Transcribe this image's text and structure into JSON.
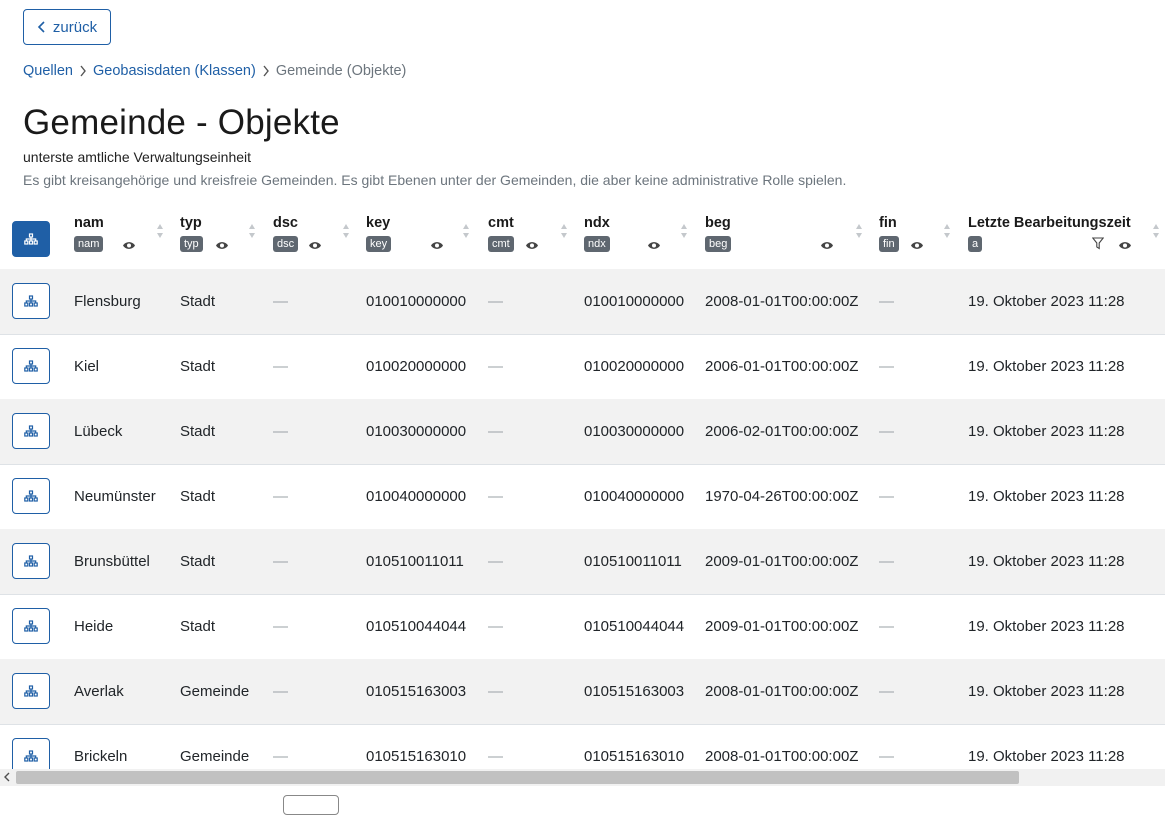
{
  "back_label": "zurück",
  "breadcrumb": {
    "items": [
      "Quellen",
      "Geobasisdaten (Klassen)"
    ],
    "current": "Gemeinde (Objekte)"
  },
  "page": {
    "title": "Gemeinde - Objekte",
    "subtitle": "unterste amtliche Verwaltungseinheit",
    "description": "Es gibt kreisangehörige und kreisfreie Gemeinden. Es gibt Ebenen unter der Gemeinden, die aber keine administrative Rolle spielen."
  },
  "table": {
    "columns": [
      {
        "name": "nam",
        "badge": "nam"
      },
      {
        "name": "typ",
        "badge": "typ"
      },
      {
        "name": "dsc",
        "badge": "dsc"
      },
      {
        "name": "key",
        "badge": "key"
      },
      {
        "name": "cmt",
        "badge": "cmt"
      },
      {
        "name": "ndx",
        "badge": "ndx"
      },
      {
        "name": "beg",
        "badge": "beg"
      },
      {
        "name": "fin",
        "badge": "fin"
      },
      {
        "name": "Letzte Bearbeitungszeit",
        "badge": "a"
      }
    ],
    "rows": [
      {
        "nam": "Flensburg",
        "typ": "Stadt",
        "dsc": "—",
        "key": "010010000000",
        "cmt": "—",
        "ndx": "010010000000",
        "beg": "2008-01-01T00:00:00Z",
        "fin": "—",
        "edited": "19. Oktober 2023 11:28"
      },
      {
        "nam": "Kiel",
        "typ": "Stadt",
        "dsc": "—",
        "key": "010020000000",
        "cmt": "—",
        "ndx": "010020000000",
        "beg": "2006-01-01T00:00:00Z",
        "fin": "—",
        "edited": "19. Oktober 2023 11:28"
      },
      {
        "nam": "Lübeck",
        "typ": "Stadt",
        "dsc": "—",
        "key": "010030000000",
        "cmt": "—",
        "ndx": "010030000000",
        "beg": "2006-02-01T00:00:00Z",
        "fin": "—",
        "edited": "19. Oktober 2023 11:28"
      },
      {
        "nam": "Neumünster",
        "typ": "Stadt",
        "dsc": "—",
        "key": "010040000000",
        "cmt": "—",
        "ndx": "010040000000",
        "beg": "1970-04-26T00:00:00Z",
        "fin": "—",
        "edited": "19. Oktober 2023 11:28"
      },
      {
        "nam": "Brunsbüttel",
        "typ": "Stadt",
        "dsc": "—",
        "key": "010510011011",
        "cmt": "—",
        "ndx": "010510011011",
        "beg": "2009-01-01T00:00:00Z",
        "fin": "—",
        "edited": "19. Oktober 2023 11:28"
      },
      {
        "nam": "Heide",
        "typ": "Stadt",
        "dsc": "—",
        "key": "010510044044",
        "cmt": "—",
        "ndx": "010510044044",
        "beg": "2009-01-01T00:00:00Z",
        "fin": "—",
        "edited": "19. Oktober 2023 11:28"
      },
      {
        "nam": "Averlak",
        "typ": "Gemeinde",
        "dsc": "—",
        "key": "010515163003",
        "cmt": "—",
        "ndx": "010515163003",
        "beg": "2008-01-01T00:00:00Z",
        "fin": "—",
        "edited": "19. Oktober 2023 11:28"
      },
      {
        "nam": "Brickeln",
        "typ": "Gemeinde",
        "dsc": "—",
        "key": "010515163010",
        "cmt": "—",
        "ndx": "010515163010",
        "beg": "2008-01-01T00:00:00Z",
        "fin": "—",
        "edited": "19. Oktober 2023 11:28"
      }
    ]
  },
  "icons": {
    "back": "chevron-left-icon",
    "separator": "chevron-right-icon",
    "row_action": "hierarchy-icon",
    "visibility": "eye-icon",
    "sort": "sort-icon",
    "filter": "filter-icon"
  },
  "colors": {
    "accent": "#1f5fa6",
    "badge": "#5f6770",
    "row_stripe": "#f2f2f2"
  }
}
